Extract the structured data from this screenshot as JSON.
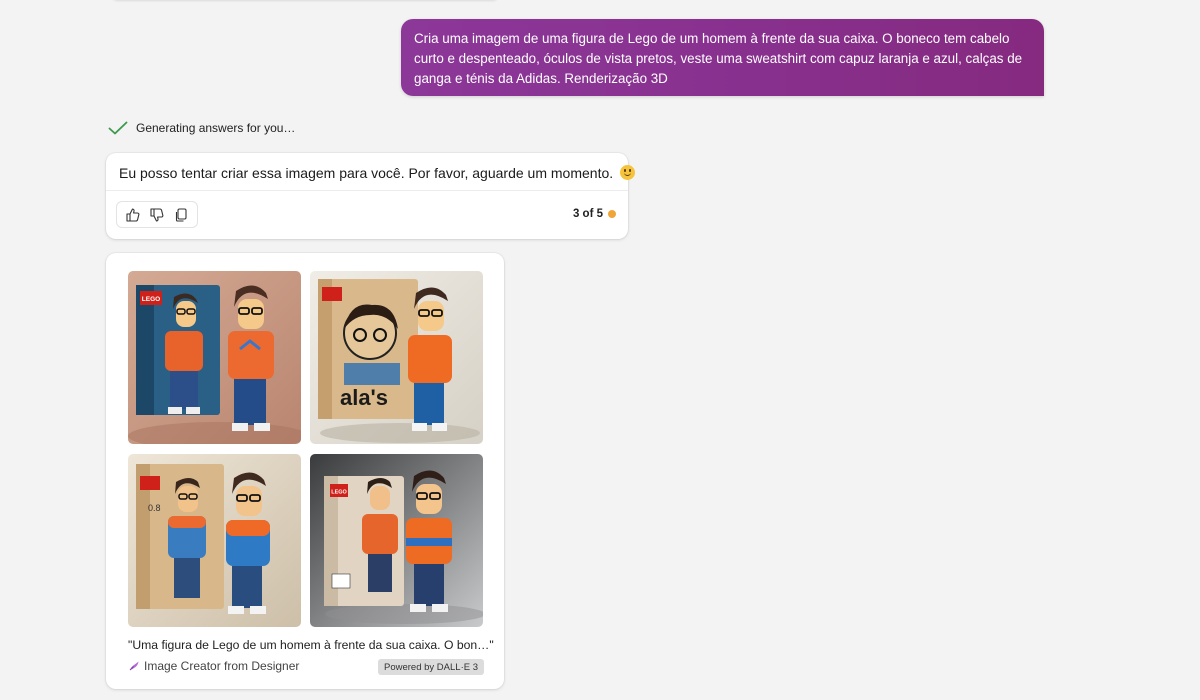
{
  "user_message": {
    "lines": [
      "Cria uma imagem de uma figura de Lego de um homem à frente da sua caixa. O boneco tem cabelo",
      "curto e despenteado, óculos de vista pretos, veste uma sweatshirt com capuz laranja e azul, calças de",
      "ganga e ténis da Adidas. Renderização 3D"
    ]
  },
  "status": {
    "text": "Generating answers for you…",
    "icon": "checkmark-icon",
    "color": "#3c9a4d"
  },
  "answer": {
    "text": "Eu posso tentar criar essa imagem para você. Por favor, aguarde um momento.",
    "emoji": "smiling-face-emoji",
    "feedback_icons": [
      "thumbs-up-icon",
      "thumbs-down-icon",
      "copy-icon"
    ],
    "counter": "3 of 5",
    "counter_dot_color": "#f0a53a"
  },
  "images": {
    "thumbnails": [
      {
        "name": "generated-image-1",
        "box_text": "LEGO"
      },
      {
        "name": "generated-image-2",
        "box_text": "ala's"
      },
      {
        "name": "generated-image-3",
        "box_text": "0.8"
      },
      {
        "name": "generated-image-4",
        "box_text": "LEGO"
      }
    ],
    "caption": "\"Uma figura de Lego de um homem à frente da sua caixa. O bon…\"",
    "creator_label": "Image Creator from Designer",
    "powered_by": "Powered by DALL·E 3"
  },
  "colors": {
    "user_bubble": "#88308e",
    "background": "#f3f3f3",
    "lego_red": "#d0201a",
    "hoodie_orange": "#e8622c"
  }
}
